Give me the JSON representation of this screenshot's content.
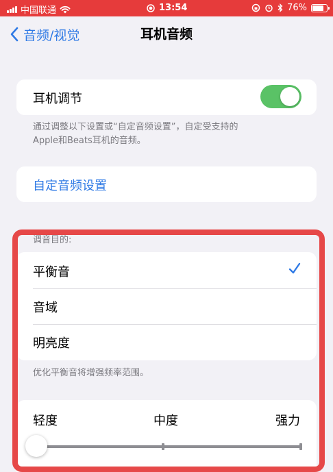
{
  "status_bar": {
    "carrier": "中国联通",
    "time": "13:54",
    "battery": "76%"
  },
  "nav": {
    "back_label": "音频/视觉",
    "title": "耳机音频"
  },
  "headphone_accommodations": {
    "label": "耳机调节",
    "enabled": true,
    "footnote_line1": "通过调整以下设置或“自定音频设置”，自定受支持的",
    "footnote_line2": "Apple和Beats耳机的音频。"
  },
  "custom_audio_setup": {
    "label": "自定音频设置"
  },
  "tune_for": {
    "header": "调音目的:",
    "options": [
      {
        "label": "平衡音",
        "selected": true
      },
      {
        "label": "音域",
        "selected": false
      },
      {
        "label": "明亮度",
        "selected": false
      }
    ],
    "footnote": "优化平衡音将增强频率范围。"
  },
  "strength": {
    "min_label": "轻度",
    "mid_label": "中度",
    "max_label": "强力",
    "level": 0
  },
  "colors": {
    "accent": "#2f7ae5",
    "toggle_on": "#5ac266",
    "highlight_frame": "#e64848",
    "status_bar": "#e63b3b"
  }
}
